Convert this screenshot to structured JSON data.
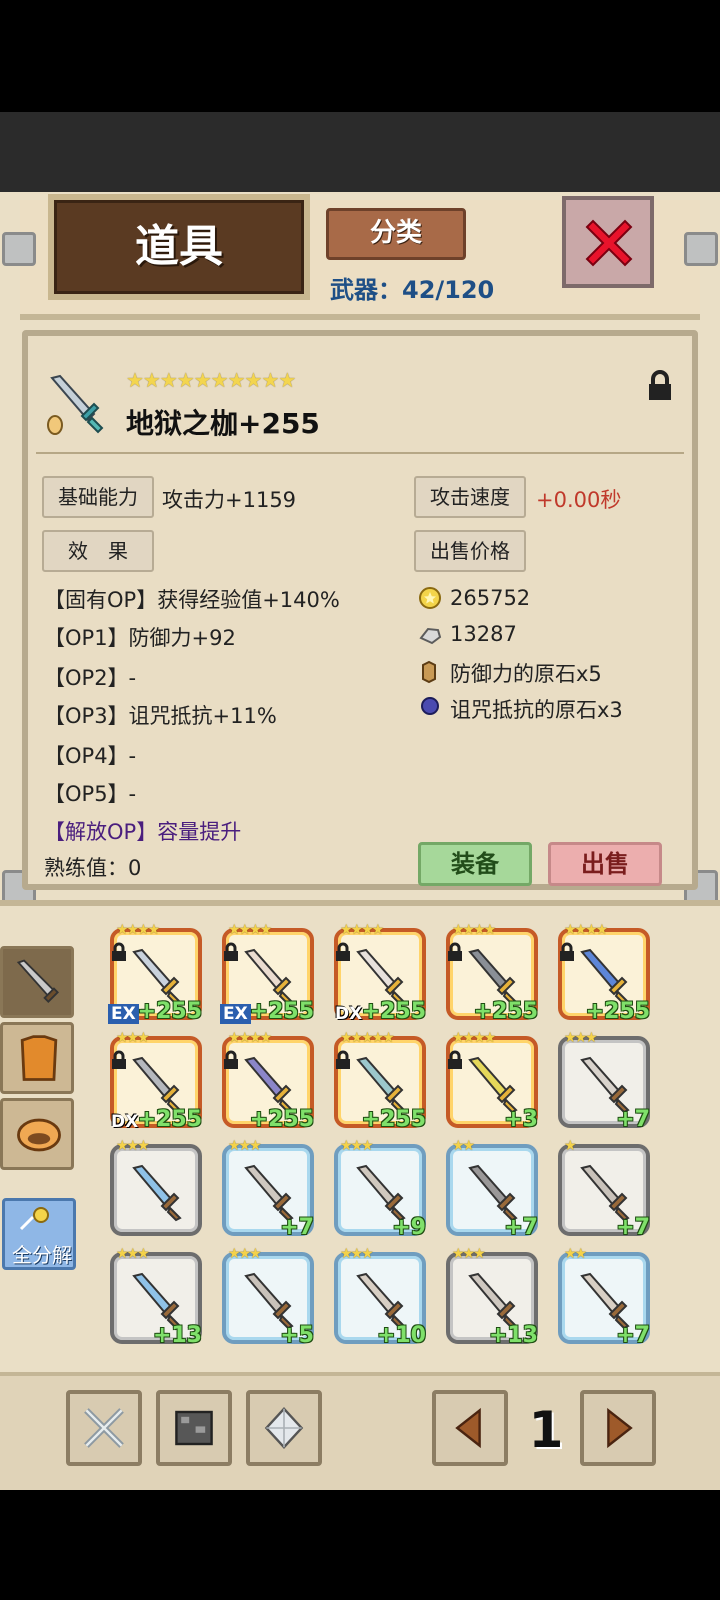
{
  "header": {
    "title": "道具",
    "category_button": "分类",
    "capacity": "武器：42/120"
  },
  "item": {
    "stars": "★★★★★★★★★★",
    "name": "地狱之枷+255",
    "base_label": "基础能力",
    "base_value": "攻击力+1159",
    "speed_label": "攻击速度",
    "speed_value": "+0.00秒",
    "effect_label": "效　果",
    "price_label": "出售价格",
    "ops": [
      "【固有OP】获得经验值+140%",
      "【OP1】防御力+92",
      "【OP2】-",
      "【OP3】诅咒抵抗+11%",
      "【OP4】-",
      "【OP5】-",
      "【解放OP】容量提升"
    ],
    "mastery": "熟练值：0",
    "prices": [
      "265752",
      "13287",
      "防御力的原石x5",
      "诅咒抵抗的原石x3"
    ],
    "equip_button": "装备",
    "sell_button": "出售"
  },
  "sidebar": {
    "disassemble": "全分解"
  },
  "pagination": {
    "page": "1"
  },
  "grid": [
    {
      "stars": "★★★★",
      "tag": "EX",
      "plus": "+255",
      "style": "gold",
      "locked": true
    },
    {
      "stars": "★★★★",
      "tag": "EX",
      "plus": "+255",
      "style": "gold",
      "locked": true
    },
    {
      "stars": "★★★★",
      "tag": "DX",
      "plus": "+255",
      "style": "gold",
      "locked": true
    },
    {
      "stars": "★★★★",
      "tag": "",
      "plus": "+255",
      "style": "gold",
      "locked": true
    },
    {
      "stars": "★★★★",
      "tag": "",
      "plus": "+255",
      "style": "gold",
      "locked": true
    },
    {
      "stars": "★★★",
      "tag": "DX",
      "plus": "+255",
      "style": "gold",
      "locked": true
    },
    {
      "stars": "★★★★",
      "tag": "",
      "plus": "+255",
      "style": "gold",
      "locked": true
    },
    {
      "stars": "★★★★★",
      "tag": "",
      "plus": "+255",
      "style": "gold",
      "locked": true
    },
    {
      "stars": "★★★★",
      "tag": "",
      "plus": "+3",
      "style": "gold",
      "locked": true
    },
    {
      "stars": "★★★",
      "tag": "",
      "plus": "+7",
      "style": "gray",
      "locked": false
    },
    {
      "stars": "★★★",
      "tag": "",
      "plus": "",
      "style": "gray",
      "locked": false
    },
    {
      "stars": "★★★",
      "tag": "",
      "plus": "+7",
      "style": "blue",
      "locked": false
    },
    {
      "stars": "★★★",
      "tag": "",
      "plus": "+9",
      "style": "blue",
      "locked": false
    },
    {
      "stars": "★★",
      "tag": "",
      "plus": "+7",
      "style": "blue",
      "locked": false
    },
    {
      "stars": "★",
      "tag": "",
      "plus": "+7",
      "style": "gray",
      "locked": false
    },
    {
      "stars": "★★★",
      "tag": "",
      "plus": "+13",
      "style": "gray",
      "locked": false
    },
    {
      "stars": "★★★",
      "tag": "",
      "plus": "+5",
      "style": "blue",
      "locked": false
    },
    {
      "stars": "★★★",
      "tag": "",
      "plus": "+10",
      "style": "blue",
      "locked": false
    },
    {
      "stars": "★★★",
      "tag": "",
      "plus": "+13",
      "style": "gray",
      "locked": false
    },
    {
      "stars": "★★",
      "tag": "",
      "plus": "+7",
      "style": "blue",
      "locked": false
    }
  ],
  "colors": {
    "capacity": "#1e4f86",
    "effect_purple": "#4a1e7e",
    "speed_red": "#c0392b",
    "plus_green": "#7fe06a"
  }
}
